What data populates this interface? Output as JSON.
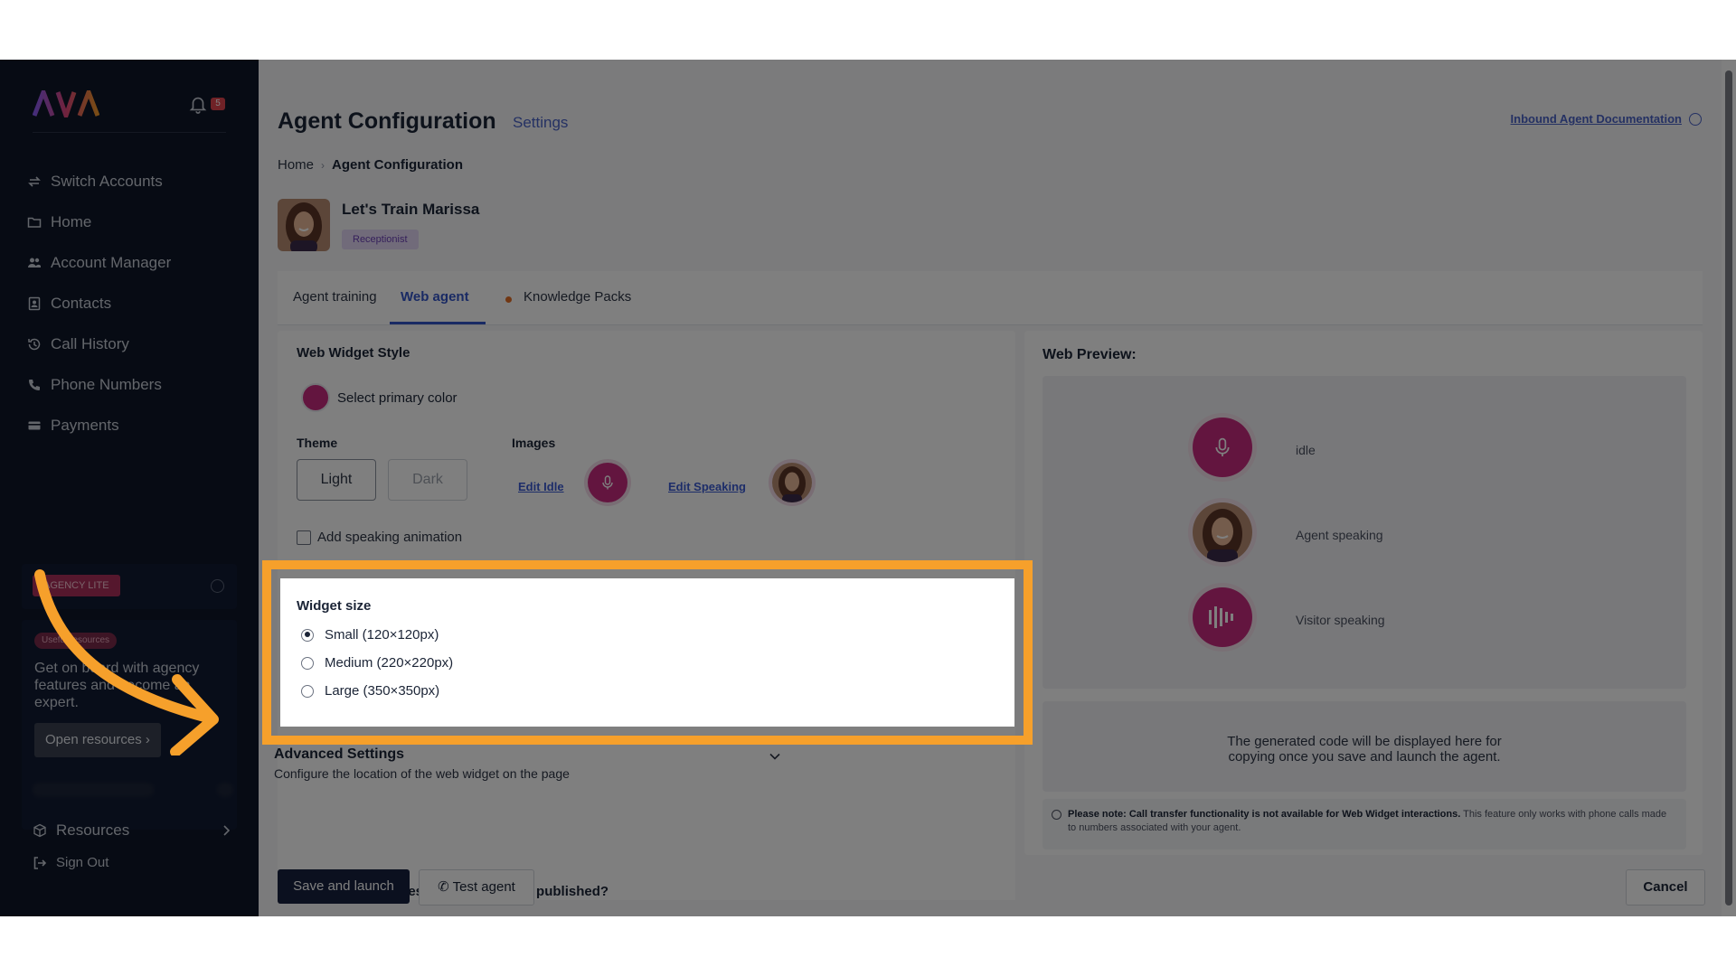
{
  "sidebar": {
    "logo_text": "AVA",
    "notification_count": "5",
    "items": [
      {
        "label": "Switch Accounts",
        "icon": "switch-icon"
      },
      {
        "label": "Home",
        "icon": "folder-icon"
      },
      {
        "label": "Account Manager",
        "icon": "users-icon"
      },
      {
        "label": "Contacts",
        "icon": "contact-book-icon"
      },
      {
        "label": "Call History",
        "icon": "history-icon"
      },
      {
        "label": "Phone Numbers",
        "icon": "phone-icon"
      },
      {
        "label": "Payments",
        "icon": "card-icon"
      }
    ],
    "agency_badge": "AGENCY LITE",
    "resources_card": {
      "pill": "Useful resources",
      "text": "Get on board with agency features and become an expert.",
      "button": "Open resources"
    },
    "resources_label": "Resources",
    "sign_out_label": "Sign Out"
  },
  "header": {
    "title": "Agent Configuration",
    "subtitle": "Settings",
    "doc_link": "Inbound Agent Documentation"
  },
  "breadcrumb": {
    "home": "Home",
    "current": "Agent Configuration"
  },
  "agent": {
    "name": "Let's Train Marissa",
    "role": "Receptionist"
  },
  "tabs": [
    {
      "label": "Agent training",
      "active": false
    },
    {
      "label": "Web agent",
      "active": true
    },
    {
      "label": "Knowledge Packs",
      "active": false
    }
  ],
  "widget_style": {
    "title": "Web Widget Style",
    "primary_color": "#c72a7f",
    "primary_color_label": "Select primary color",
    "theme_title": "Theme",
    "theme_light": "Light",
    "theme_dark": "Dark",
    "images_title": "Images",
    "edit_idle": "Edit Idle",
    "edit_speaking": "Edit Speaking",
    "speaking_animation_label": "Add speaking animation"
  },
  "widget_size": {
    "title": "Widget size",
    "options": [
      {
        "label": "Small (120×120px)",
        "selected": true
      },
      {
        "label": "Medium (220×220px)",
        "selected": false
      },
      {
        "label": "Large (350×350px)",
        "selected": false
      }
    ]
  },
  "advanced": {
    "title": "Advanced Settings",
    "description": "Configure the location of the web widget on the page"
  },
  "publish_question": "On which websites will the agent be published?",
  "preview": {
    "title": "Web Preview:",
    "states": [
      {
        "label": "idle",
        "icon": "microphone-icon"
      },
      {
        "label": "Agent speaking",
        "icon": "agent-avatar"
      },
      {
        "label": "Visitor speaking",
        "icon": "waveform-icon"
      }
    ],
    "code_placeholder_line1": "The generated code will be displayed here for",
    "code_placeholder_line2": "copying once you save and launch the agent.",
    "note_bold": "Please note: Call transfer functionality is not available for Web Widget interactions.",
    "note_rest": " This feature only works with phone calls made to numbers associated with your agent."
  },
  "footer": {
    "save_label": "Save and launch",
    "test_label": "Test agent",
    "cancel_label": "Cancel"
  },
  "highlight_color": "#f6a02b"
}
